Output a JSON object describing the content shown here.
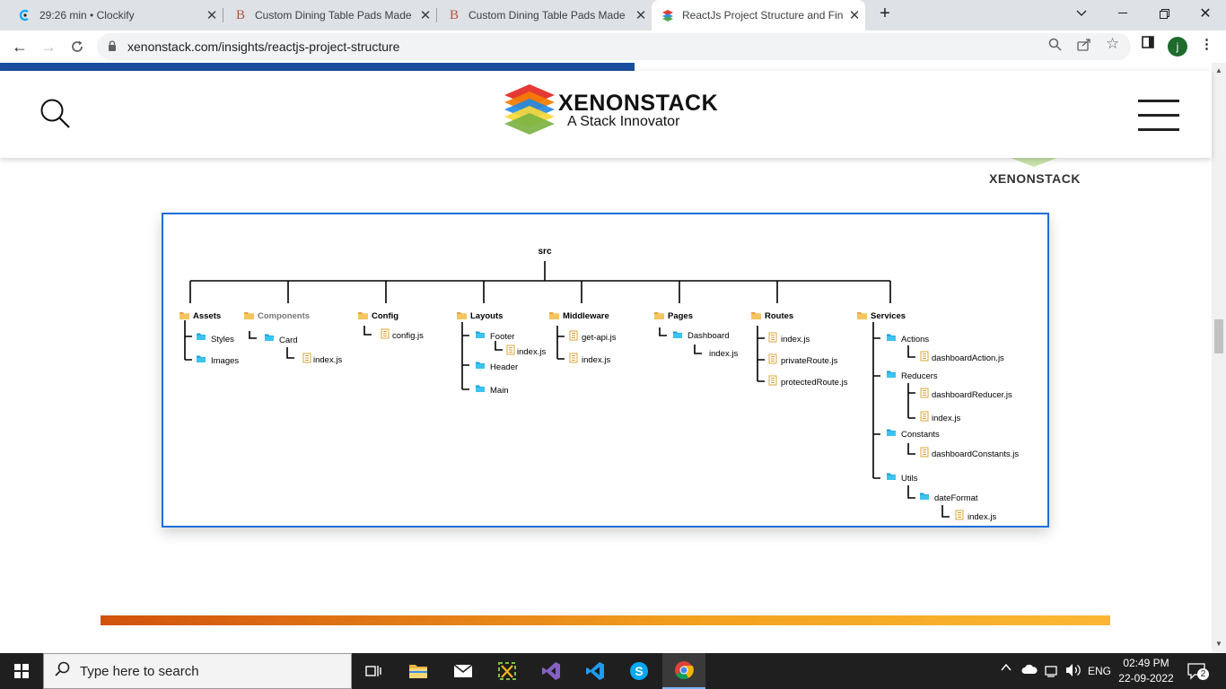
{
  "browser": {
    "tabs": [
      {
        "title": "29:26 min • Clockify",
        "favicon": "clockify-icon"
      },
      {
        "title": "Custom Dining Table Pads Made",
        "favicon": "b-letter-icon"
      },
      {
        "title": "Custom Dining Table Pads Made",
        "favicon": "b-letter-icon"
      },
      {
        "title": "ReactJs Project Structure and Fin",
        "favicon": "xenonstack-icon"
      }
    ],
    "url": "xenonstack.com/insights/reactjs-project-structure",
    "profile_initial": "j"
  },
  "site": {
    "logo_name": "XENONSTACK",
    "logo_tagline": "A Stack Innovator",
    "side_brand": "XENONSTACK"
  },
  "diagram": {
    "root": "src",
    "folders": {
      "assets": "Assets",
      "styles": "Styles",
      "images": "Images",
      "components": "Components",
      "card": "Card",
      "card_index": "index.js",
      "config": "Config",
      "config_js": "config.js",
      "layouts": "Layouts",
      "footer": "Footer",
      "footer_index": "index.js",
      "header": "Header",
      "main": "Main",
      "middleware": "Middleware",
      "getapi": "get-api.js",
      "mw_index": "index.js",
      "pages": "Pages",
      "dashboard": "Dashboard",
      "dash_index": "index.js",
      "routes": "Routes",
      "rt_index": "index.js",
      "private_route": "privateRoute.js",
      "protected_route": "protectedRoute.js",
      "services": "Services",
      "actions": "Actions",
      "dashboard_action": "dashboardAction.js",
      "reducers": "Reducers",
      "dashboard_reducer": "dashboardReducer.js",
      "red_index": "index.js",
      "constants": "Constants",
      "dashboard_constants": "dashboardConstants.js",
      "utils": "Utils",
      "date_format": "dateFormat",
      "utils_index": "index.js"
    }
  },
  "taskbar": {
    "search_placeholder": "Type here to search",
    "language": "ENG",
    "time": "02:49 PM",
    "date": "22-09-2022",
    "notification_count": "2"
  }
}
